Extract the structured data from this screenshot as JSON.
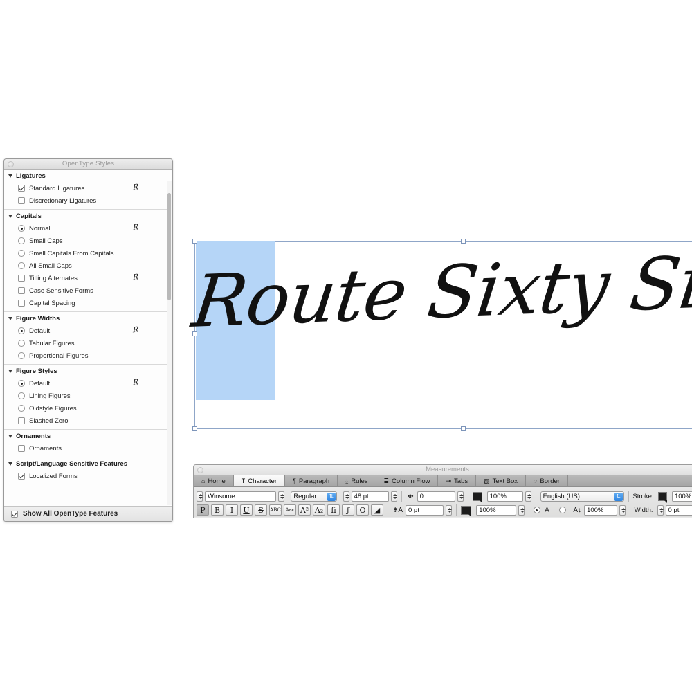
{
  "opentype_panel": {
    "title": "OpenType Styles",
    "close_icon": "close-icon",
    "preview_glyph": "R",
    "groups": [
      {
        "title": "Ligatures",
        "rows": [
          {
            "type": "checkbox",
            "label": "Standard Ligatures",
            "checked": true,
            "preview": true
          },
          {
            "type": "checkbox",
            "label": "Discretionary Ligatures",
            "checked": false,
            "preview": false
          }
        ]
      },
      {
        "title": "Capitals",
        "rows": [
          {
            "type": "radio",
            "label": "Normal",
            "checked": true,
            "preview": true
          },
          {
            "type": "radio",
            "label": "Small Caps",
            "checked": false,
            "preview": false
          },
          {
            "type": "radio",
            "label": "Small Capitals From Capitals",
            "checked": false,
            "preview": false
          },
          {
            "type": "radio",
            "label": "All Small Caps",
            "checked": false,
            "preview": false
          },
          {
            "type": "checkbox",
            "label": "Titling Alternates",
            "checked": false,
            "preview": true
          },
          {
            "type": "checkbox",
            "label": "Case Sensitive Forms",
            "checked": false,
            "preview": false
          },
          {
            "type": "checkbox",
            "label": "Capital Spacing",
            "checked": false,
            "preview": false
          }
        ]
      },
      {
        "title": "Figure Widths",
        "rows": [
          {
            "type": "radio",
            "label": "Default",
            "checked": true,
            "preview": true
          },
          {
            "type": "radio",
            "label": "Tabular Figures",
            "checked": false,
            "preview": false
          },
          {
            "type": "radio",
            "label": "Proportional Figures",
            "checked": false,
            "preview": false
          }
        ]
      },
      {
        "title": "Figure Styles",
        "rows": [
          {
            "type": "radio",
            "label": "Default",
            "checked": true,
            "preview": true
          },
          {
            "type": "radio",
            "label": "Lining Figures",
            "checked": false,
            "preview": false
          },
          {
            "type": "radio",
            "label": "Oldstyle Figures",
            "checked": false,
            "preview": false
          },
          {
            "type": "checkbox",
            "label": "Slashed Zero",
            "checked": false,
            "preview": false
          }
        ]
      },
      {
        "title": "Ornaments",
        "rows": [
          {
            "type": "checkbox",
            "label": "Ornaments",
            "checked": false,
            "preview": false
          }
        ]
      },
      {
        "title": "Script/Language Sensitive Features",
        "rows": [
          {
            "type": "checkbox",
            "label": "Localized Forms",
            "checked": true,
            "preview": false
          }
        ]
      }
    ],
    "footer": {
      "label": "Show All OpenType Features",
      "checked": true
    }
  },
  "canvas": {
    "text": "Route Sixty Six",
    "selection_highlight_color": "#b5d5f7",
    "selection_frame_color": "#8fa6c8"
  },
  "measurements": {
    "title": "Measurements",
    "close_icon": "close-icon",
    "tabs": [
      {
        "label": "Home",
        "icon": "home-icon",
        "glyph": "⌂",
        "active": false
      },
      {
        "label": "Character",
        "icon": "character-icon",
        "glyph": "T",
        "active": true
      },
      {
        "label": "Paragraph",
        "icon": "paragraph-icon",
        "glyph": "¶",
        "active": false
      },
      {
        "label": "Rules",
        "icon": "rules-icon",
        "glyph": "⤓",
        "active": false
      },
      {
        "label": "Column Flow",
        "icon": "column-flow-icon",
        "glyph": "≣",
        "active": false
      },
      {
        "label": "Tabs",
        "icon": "tabs-icon",
        "glyph": "⇥",
        "active": false
      },
      {
        "label": "Text Box",
        "icon": "text-box-icon",
        "glyph": "▧",
        "active": false
      },
      {
        "label": "Border",
        "icon": "border-icon",
        "glyph": "◌",
        "active": false
      }
    ],
    "row1": {
      "font_family": "Winsome",
      "font_style": "Regular",
      "font_size": "48 pt",
      "tracking_icon": "tracking-icon",
      "tracking_value": "0",
      "text_color_swatch": "#1c1c1c",
      "color_shade": "100%",
      "language": "English (US)",
      "stroke_label": "Stroke:",
      "stroke_swatch": "#1c1c1c",
      "stroke_shade": "100%"
    },
    "row2": {
      "style_buttons": [
        {
          "name": "plain",
          "glyph": "P",
          "active": true
        },
        {
          "name": "bold",
          "glyph": "B",
          "active": false
        },
        {
          "name": "italic",
          "glyph": "I",
          "active": false
        },
        {
          "name": "underline",
          "glyph": "U",
          "active": false
        },
        {
          "name": "strikethrough",
          "glyph": "S",
          "active": false
        },
        {
          "name": "all-caps",
          "glyph": "ABC",
          "active": false
        },
        {
          "name": "small-caps",
          "glyph": "Aʙᴄ",
          "active": false
        },
        {
          "name": "superscript",
          "glyph": "A²",
          "active": false
        },
        {
          "name": "subscript",
          "glyph": "A₂",
          "active": false
        },
        {
          "name": "ligature",
          "glyph": "ﬁ",
          "active": false
        },
        {
          "name": "script",
          "glyph": "ƒ",
          "active": false
        },
        {
          "name": "outline",
          "glyph": "O",
          "active": false
        },
        {
          "name": "shadow",
          "glyph": "◢",
          "active": false
        }
      ],
      "baseline_icon": "baseline-shift-icon",
      "baseline_value": "0 pt",
      "background_swatch": "#1c1c1c",
      "background_shade": "100%",
      "direction_ltr": true,
      "scale_icon": "horizontal-scale-icon",
      "scale_value": "100%",
      "width_label": "Width:",
      "width_value": "0 pt"
    }
  }
}
